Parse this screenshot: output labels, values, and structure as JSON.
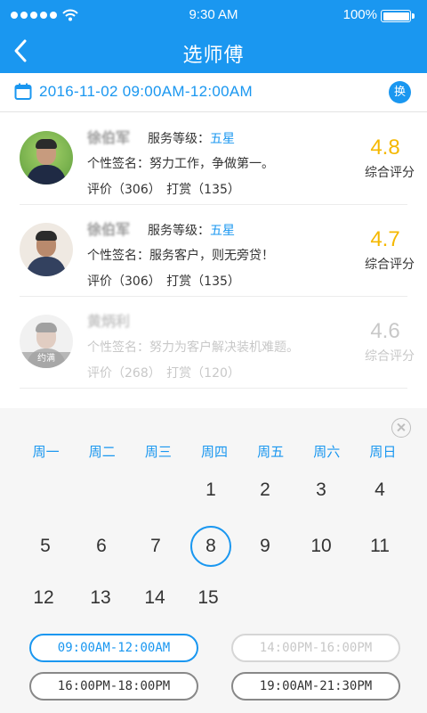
{
  "status_bar": {
    "time": "9:30 AM",
    "battery": "100%"
  },
  "nav": {
    "title": "选师傅"
  },
  "date_bar": {
    "text": "2016-11-02  09:00AM-12:00AM",
    "swap_label": "换"
  },
  "workers": [
    {
      "name": "徐伯军",
      "level_label": "服务等级：",
      "level_value": "五星",
      "signature": "个性签名：努力工作，争做第一。",
      "stats": "评价（306） 打赏（135）",
      "score": "4.8",
      "score_label": "综合评分",
      "badge": ""
    },
    {
      "name": "徐伯军",
      "level_label": "服务等级：",
      "level_value": "五星",
      "signature": "个性签名：服务客户，则无旁贷！",
      "stats": "评价（306） 打赏（135）",
      "score": "4.7",
      "score_label": "综合评分",
      "badge": ""
    },
    {
      "name": "黄炳利",
      "level_label": "",
      "level_value": "",
      "signature": "个性签名：努力为客户解决装机难题。",
      "stats": "评价（268） 打赏（120）",
      "score": "4.6",
      "score_label": "综合评分",
      "badge": "约满"
    }
  ],
  "calendar": {
    "weekdays": [
      "周一",
      "周二",
      "周三",
      "周四",
      "周五",
      "周六",
      "周日"
    ],
    "days": [
      "1",
      "2",
      "3",
      "4",
      "5",
      "6",
      "7",
      "8",
      "9",
      "10",
      "11",
      "12",
      "13",
      "14",
      "15"
    ],
    "selected_day": "8"
  },
  "time_slots": [
    {
      "label": "09:00AM-12:00AM",
      "state": "active"
    },
    {
      "label": "14:00PM-16:00PM",
      "state": "disabled"
    },
    {
      "label": "16:00PM-18:00PM",
      "state": "normal"
    },
    {
      "label": "19:00AM-21:30PM",
      "state": "normal"
    }
  ],
  "colors": {
    "primary": "#1a97f0",
    "score": "#f5b800"
  }
}
